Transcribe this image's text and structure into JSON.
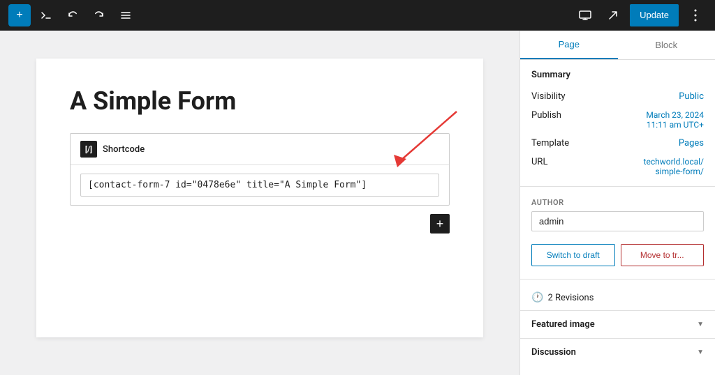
{
  "toolbar": {
    "add_label": "+",
    "update_label": "Update",
    "pencil_icon": "✏",
    "undo_icon": "↩",
    "redo_icon": "↪",
    "list_icon": "≡",
    "monitor_icon": "□",
    "share_icon": "↗",
    "dots_icon": "⋮"
  },
  "editor": {
    "page_title": "A Simple Form",
    "shortcode_icon_label": "[/]",
    "shortcode_label": "Shortcode",
    "shortcode_value": "[contact-form-7 id=\"0478e6e\" title=\"A Simple Form\"]"
  },
  "sidebar": {
    "tab_page": "Page",
    "tab_block": "Block",
    "summary_title": "Summary",
    "visibility_label": "Visibility",
    "visibility_value": "Public",
    "publish_label": "Publish",
    "publish_value": "March 23, 2024\n11:11 am UTC+",
    "template_label": "Template",
    "template_value": "Pages",
    "url_label": "URL",
    "url_value": "techworld.local/\nsimple-form/",
    "author_label": "AUTHOR",
    "author_value": "admin",
    "btn_draft": "Switch to draft",
    "btn_trash": "Move to tr...",
    "revisions_icon": "🕐",
    "revisions_text": "2 Revisions",
    "featured_image_title": "Featured image",
    "discussion_title": "Discussion"
  }
}
